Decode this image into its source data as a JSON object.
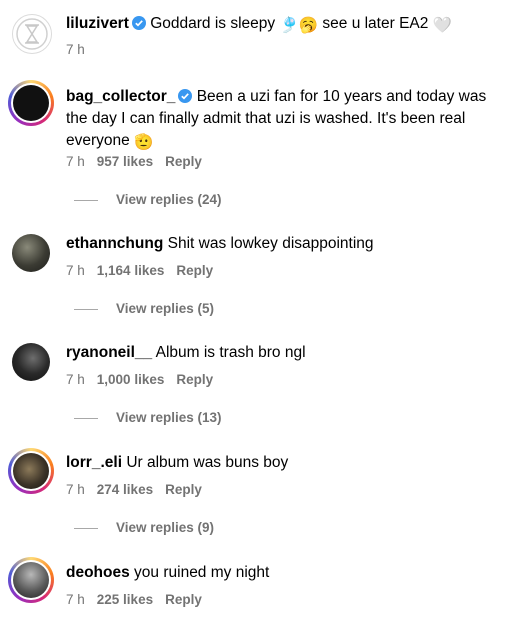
{
  "comments": [
    {
      "username": "liluzivert",
      "verified": true,
      "text_before": "Goddard is sleepy",
      "emoji1": "🎐",
      "emoji2": "🥱",
      "text_after": "see u later EA2",
      "emoji3": "🤍",
      "time": "7 h"
    },
    {
      "username": "bag_collector_",
      "verified": true,
      "text": "Been a uzi fan for 10 years and today was the day I can finally admit that uzi is washed. It's been real everyone",
      "emoji": "🫡",
      "time": "7 h",
      "likes": "957 likes",
      "reply": "Reply",
      "view_replies": "View replies (24)"
    },
    {
      "username": "ethannchung",
      "text": "Shit was lowkey disappointing",
      "time": "7 h",
      "likes": "1,164 likes",
      "reply": "Reply",
      "view_replies": "View replies (5)"
    },
    {
      "username": "ryanoneil__",
      "text": "Album is trash bro ngl",
      "time": "7 h",
      "likes": "1,000 likes",
      "reply": "Reply",
      "view_replies": "View replies (13)"
    },
    {
      "username": "lorr_.eli",
      "text": "Ur album was buns boy",
      "time": "7 h",
      "likes": "274 likes",
      "reply": "Reply",
      "view_replies": "View replies (9)"
    },
    {
      "username": "deohoes",
      "text": "you ruined my night",
      "time": "7 h",
      "likes": "225 likes",
      "reply": "Reply"
    }
  ],
  "icons": {
    "verified": "verified-badge-icon"
  },
  "colors": {
    "verified_blue": "#3897f0",
    "meta_gray": "#737373",
    "story_ring": "#d62976"
  }
}
